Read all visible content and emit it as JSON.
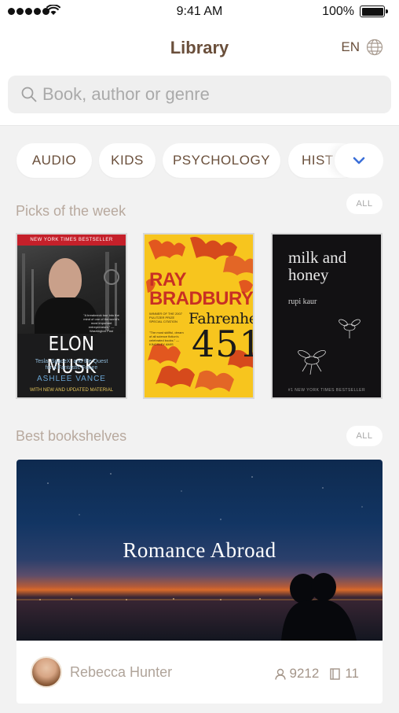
{
  "status_bar": {
    "time": "9:41 AM",
    "battery_percent": "100%",
    "battery_level": 1.0
  },
  "nav": {
    "title": "Library",
    "language": "EN"
  },
  "search": {
    "placeholder": "Book, author or genre",
    "value": ""
  },
  "categories": [
    "AUDIO",
    "KIDS",
    "PSYCHOLOGY",
    "HIST"
  ],
  "picks": {
    "title": "Picks of the week",
    "all_label": "ALL",
    "books": [
      {
        "banner": "NEW YORK TIMES BESTSELLER",
        "quote": "\"A breakneck tour into the mind of one of the world's most important entrepreneurs.\" —Washington Post",
        "title": "ELON MUSK",
        "subtitle": "Tesla, SpaceX, and the Quest for a Fantastic Future",
        "author": "ASHLEE VANCE",
        "footer": "WITH NEW AND UPDATED MATERIAL"
      },
      {
        "author_first": "RAY",
        "author_last": "BRADBURY",
        "blurb": "WINNER OF THE 2007 PULITZER PRIZE SPECIAL CITATION",
        "title": "Fahrenheit",
        "number": "451",
        "blurb2": "\"The most skillful, dream of all science fiction's celebrated books.\" —KINGSLEY AMIS"
      },
      {
        "title": "milk and honey",
        "author": "rupi kaur",
        "footer": "#1 NEW YORK TIMES BESTSELLER"
      }
    ]
  },
  "shelves": {
    "title": "Best bookshelves",
    "all_label": "ALL",
    "featured": {
      "title": "Romance Abroad",
      "owner": "Rebecca Hunter",
      "followers": "9212",
      "books": "11"
    }
  },
  "colors": {
    "accent": "#3b6fd8",
    "brand_brown": "#6a4f3b",
    "muted": "#b8a99e"
  }
}
